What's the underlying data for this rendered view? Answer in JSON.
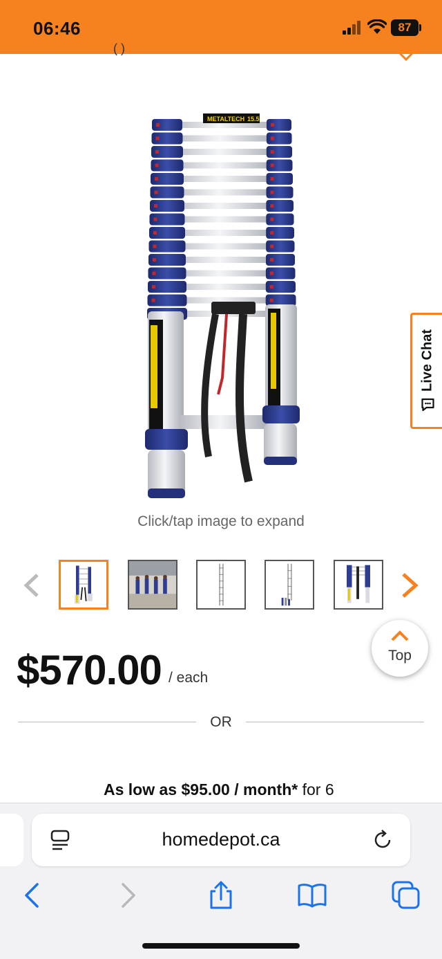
{
  "status_bar": {
    "time": "06:46",
    "battery": "87"
  },
  "product": {
    "image_alt": "Telescoping aluminum ladder",
    "brand_text": "METALTECH",
    "size_text": "15.5",
    "expand_hint": "Click/tap image to expand",
    "thumbnails": [
      {
        "name": "ladder-extended",
        "active": true
      },
      {
        "name": "people-on-ladders",
        "active": false
      },
      {
        "name": "ladder-fully-extended",
        "active": false
      },
      {
        "name": "ladder-extended-with-parts",
        "active": false
      },
      {
        "name": "ladder-collapsed",
        "active": false
      }
    ]
  },
  "live_chat": {
    "label": "Live Chat"
  },
  "top_button": {
    "label": "Top"
  },
  "pricing": {
    "price": "$570.00",
    "unit": "/ each",
    "or": "OR",
    "finance_bold": "As low as $95.00 / month*",
    "finance_rest": " for 6"
  },
  "browser": {
    "url": "homedepot.ca"
  },
  "colors": {
    "brand_orange": "#f6821f",
    "ladder_blue": "#2e3d8f"
  }
}
